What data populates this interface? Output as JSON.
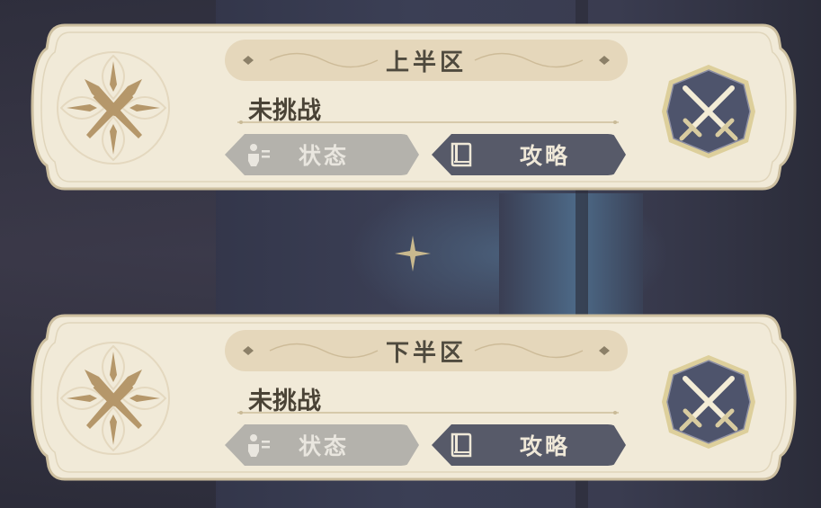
{
  "panels": [
    {
      "title": "上半区",
      "status": "未挑战",
      "status_button": {
        "label": "状态",
        "icon": "character-status-icon"
      },
      "guide_button": {
        "label": "攻略",
        "icon": "book-icon"
      }
    },
    {
      "title": "下半区",
      "status": "未挑战",
      "status_button": {
        "label": "状态",
        "icon": "character-status-icon"
      },
      "guide_button": {
        "label": "攻略",
        "icon": "book-icon"
      }
    }
  ],
  "colors": {
    "panel_bg": "#f1ead8",
    "panel_border": "#cdbf9f",
    "banner_bg": "#e5d7bb",
    "status_button_bg": "#b4b2ac",
    "guide_button_bg": "#575a69",
    "badge_bg": "#4e546c",
    "badge_border": "#ddcf9b"
  }
}
